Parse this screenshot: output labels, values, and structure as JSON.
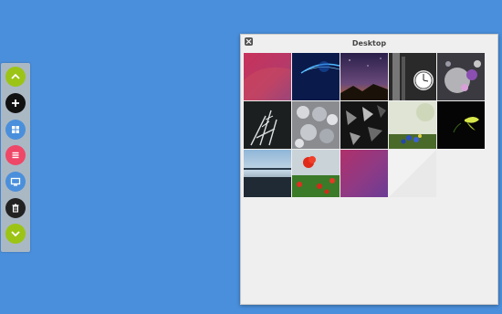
{
  "window": {
    "title": "Desktop",
    "close_icon": "close-icon"
  },
  "dock": {
    "items": [
      {
        "name": "scroll-up",
        "icon": "chevron-up-icon",
        "color": "#9cc416"
      },
      {
        "name": "add",
        "icon": "plus-icon",
        "color": "#111111"
      },
      {
        "name": "grid-view",
        "icon": "grid-icon",
        "color": "#4a8fdc"
      },
      {
        "name": "list-view",
        "icon": "list-icon",
        "color": "#ef4767"
      },
      {
        "name": "wallpaper",
        "icon": "monitor-icon",
        "color": "#4a8fdc"
      },
      {
        "name": "delete",
        "icon": "trash-icon",
        "color": "#222222"
      },
      {
        "name": "scroll-down",
        "icon": "chevron-down-icon",
        "color": "#9cc416"
      }
    ]
  },
  "thumbnails": [
    {
      "name": "pink-gradient"
    },
    {
      "name": "blue-light-streak"
    },
    {
      "name": "mountain-night-sky"
    },
    {
      "name": "bw-clock-tower"
    },
    {
      "name": "glass-bokeh"
    },
    {
      "name": "frosted-grass"
    },
    {
      "name": "ice-crystals"
    },
    {
      "name": "dark-leaves"
    },
    {
      "name": "blue-flowers"
    },
    {
      "name": "yellow-flower-black"
    },
    {
      "name": "lake-horizon"
    },
    {
      "name": "red-poppies"
    },
    {
      "name": "purple-gradient"
    },
    {
      "name": "white-plain"
    }
  ]
}
